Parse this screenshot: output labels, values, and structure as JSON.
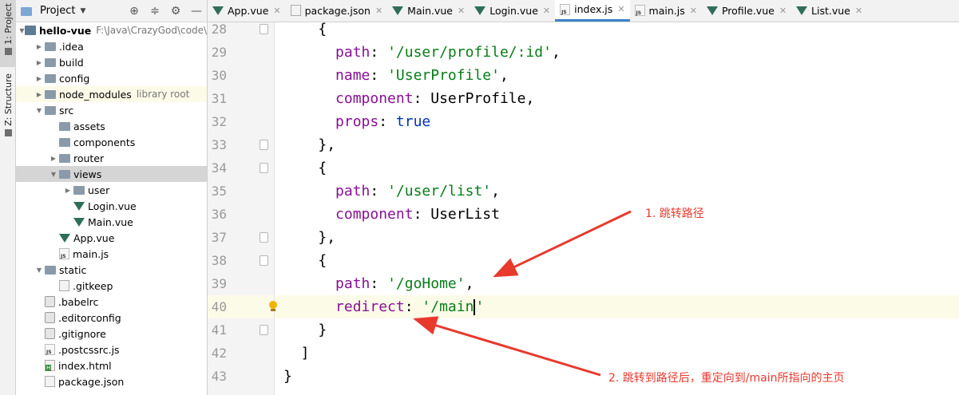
{
  "tool_strip": {
    "project_tab": "1: Project",
    "structure_tab": "Z: Structure"
  },
  "project_panel": {
    "title": "Project",
    "tree": [
      {
        "label": "hello-vue",
        "hint": "F:\\Java\\CrazyGod\\code\\",
        "icon": "module-icon",
        "depth": 0,
        "expanded": true,
        "bold": true
      },
      {
        "label": ".idea",
        "icon": "folder-icon",
        "depth": 1,
        "expanded": false
      },
      {
        "label": "build",
        "icon": "folder-icon",
        "depth": 1,
        "expanded": false
      },
      {
        "label": "config",
        "icon": "folder-icon",
        "depth": 1,
        "expanded": false
      },
      {
        "label": "node_modules",
        "hint": "library root",
        "icon": "folder-icon",
        "depth": 1,
        "expanded": false,
        "highlight": true
      },
      {
        "label": "src",
        "icon": "folder-icon",
        "depth": 1,
        "expanded": true
      },
      {
        "label": "assets",
        "icon": "folder-icon",
        "depth": 2,
        "leaf": true
      },
      {
        "label": "components",
        "icon": "folder-icon",
        "depth": 2,
        "leaf": true
      },
      {
        "label": "router",
        "icon": "folder-icon",
        "depth": 2,
        "expanded": false
      },
      {
        "label": "views",
        "icon": "folder-icon",
        "depth": 2,
        "expanded": true,
        "selected": true
      },
      {
        "label": "user",
        "icon": "folder-icon",
        "depth": 3,
        "expanded": false
      },
      {
        "label": "Login.vue",
        "icon": "vue-icon",
        "depth": 3,
        "leaf": true
      },
      {
        "label": "Main.vue",
        "icon": "vue-icon",
        "depth": 3,
        "leaf": true
      },
      {
        "label": "App.vue",
        "icon": "vue-icon",
        "depth": 2,
        "leaf": true
      },
      {
        "label": "main.js",
        "icon": "js-icon",
        "depth": 2,
        "leaf": true
      },
      {
        "label": "static",
        "icon": "folder-icon",
        "depth": 1,
        "expanded": true
      },
      {
        "label": ".gitkeep",
        "icon": "file-icon",
        "depth": 2,
        "leaf": true
      },
      {
        "label": ".babelrc",
        "icon": "config-file-icon",
        "depth": 1,
        "leaf": true
      },
      {
        "label": ".editorconfig",
        "icon": "config-file-icon",
        "depth": 1,
        "leaf": true
      },
      {
        "label": ".gitignore",
        "icon": "config-file-icon",
        "depth": 1,
        "leaf": true
      },
      {
        "label": ".postcssrc.js",
        "icon": "js-icon",
        "depth": 1,
        "leaf": true
      },
      {
        "label": "index.html",
        "icon": "html-icon",
        "depth": 1,
        "leaf": true
      },
      {
        "label": "package.json",
        "icon": "json-icon",
        "depth": 1,
        "leaf": true
      }
    ]
  },
  "editor_tabs": [
    {
      "label": "App.vue",
      "icon": "vue-icon",
      "active": false
    },
    {
      "label": "package.json",
      "icon": "json-icon",
      "active": false
    },
    {
      "label": "Main.vue",
      "icon": "vue-icon",
      "active": false
    },
    {
      "label": "Login.vue",
      "icon": "vue-icon",
      "active": false
    },
    {
      "label": "index.js",
      "icon": "js-icon",
      "active": true
    },
    {
      "label": "main.js",
      "icon": "js-icon",
      "active": false
    },
    {
      "label": "Profile.vue",
      "icon": "vue-icon",
      "active": false
    },
    {
      "label": "List.vue",
      "icon": "vue-icon",
      "active": false
    }
  ],
  "code_lines": [
    {
      "num": "28",
      "indent": 4,
      "tokens": [
        {
          "t": "{",
          "c": ""
        }
      ],
      "fold": true
    },
    {
      "num": "29",
      "indent": 6,
      "tokens": [
        {
          "t": "path",
          "c": "k"
        },
        {
          "t": ": ",
          "c": ""
        },
        {
          "t": "'/user/profile/:id'",
          "c": "s"
        },
        {
          "t": ",",
          "c": ""
        }
      ]
    },
    {
      "num": "30",
      "indent": 6,
      "tokens": [
        {
          "t": "name",
          "c": "k"
        },
        {
          "t": ": ",
          "c": ""
        },
        {
          "t": "'UserProfile'",
          "c": "s"
        },
        {
          "t": ",",
          "c": ""
        }
      ]
    },
    {
      "num": "31",
      "indent": 6,
      "tokens": [
        {
          "t": "component",
          "c": "k"
        },
        {
          "t": ": UserProfile,",
          "c": ""
        }
      ]
    },
    {
      "num": "32",
      "indent": 6,
      "tokens": [
        {
          "t": "props",
          "c": "k"
        },
        {
          "t": ": ",
          "c": ""
        },
        {
          "t": "true",
          "c": "b"
        }
      ]
    },
    {
      "num": "33",
      "indent": 4,
      "tokens": [
        {
          "t": "},",
          "c": ""
        }
      ],
      "fold": true
    },
    {
      "num": "34",
      "indent": 4,
      "tokens": [
        {
          "t": "{",
          "c": ""
        }
      ],
      "fold": true
    },
    {
      "num": "35",
      "indent": 6,
      "tokens": [
        {
          "t": "path",
          "c": "k"
        },
        {
          "t": ": ",
          "c": ""
        },
        {
          "t": "'/user/list'",
          "c": "s"
        },
        {
          "t": ",",
          "c": ""
        }
      ]
    },
    {
      "num": "36",
      "indent": 6,
      "tokens": [
        {
          "t": "component",
          "c": "k"
        },
        {
          "t": ": UserList",
          "c": ""
        }
      ]
    },
    {
      "num": "37",
      "indent": 4,
      "tokens": [
        {
          "t": "},",
          "c": ""
        }
      ],
      "fold": true
    },
    {
      "num": "38",
      "indent": 4,
      "tokens": [
        {
          "t": "{",
          "c": ""
        }
      ],
      "fold": true
    },
    {
      "num": "39",
      "indent": 6,
      "tokens": [
        {
          "t": "path",
          "c": "k"
        },
        {
          "t": ": ",
          "c": ""
        },
        {
          "t": "'/goHome'",
          "c": "s"
        },
        {
          "t": ",",
          "c": ""
        }
      ]
    },
    {
      "num": "40",
      "indent": 6,
      "tokens": [
        {
          "t": "redirect",
          "c": "k"
        },
        {
          "t": ": ",
          "c": ""
        },
        {
          "t": "'/main",
          "c": "s"
        },
        {
          "t": "|caret|",
          "c": "caret"
        },
        {
          "t": "'",
          "c": "s"
        }
      ],
      "current": true,
      "bulb": true
    },
    {
      "num": "41",
      "indent": 4,
      "tokens": [
        {
          "t": "}",
          "c": ""
        }
      ],
      "fold": true
    },
    {
      "num": "42",
      "indent": 2,
      "tokens": [
        {
          "t": "]",
          "c": ""
        }
      ]
    },
    {
      "num": "43",
      "indent": 0,
      "tokens": [
        {
          "t": "}",
          "c": ""
        }
      ]
    }
  ],
  "annotations": [
    {
      "text": "1. 跳转路径"
    },
    {
      "text": "2. 跳转到路径后，重定向到/main所指向的主页"
    }
  ],
  "colors": {
    "annotation": "#e8392d",
    "keyword": "#871094",
    "string": "#067d17",
    "literal": "#0033b3",
    "active_tab_underline": "#4083c9",
    "vue_icon": "#2f6e5a"
  }
}
